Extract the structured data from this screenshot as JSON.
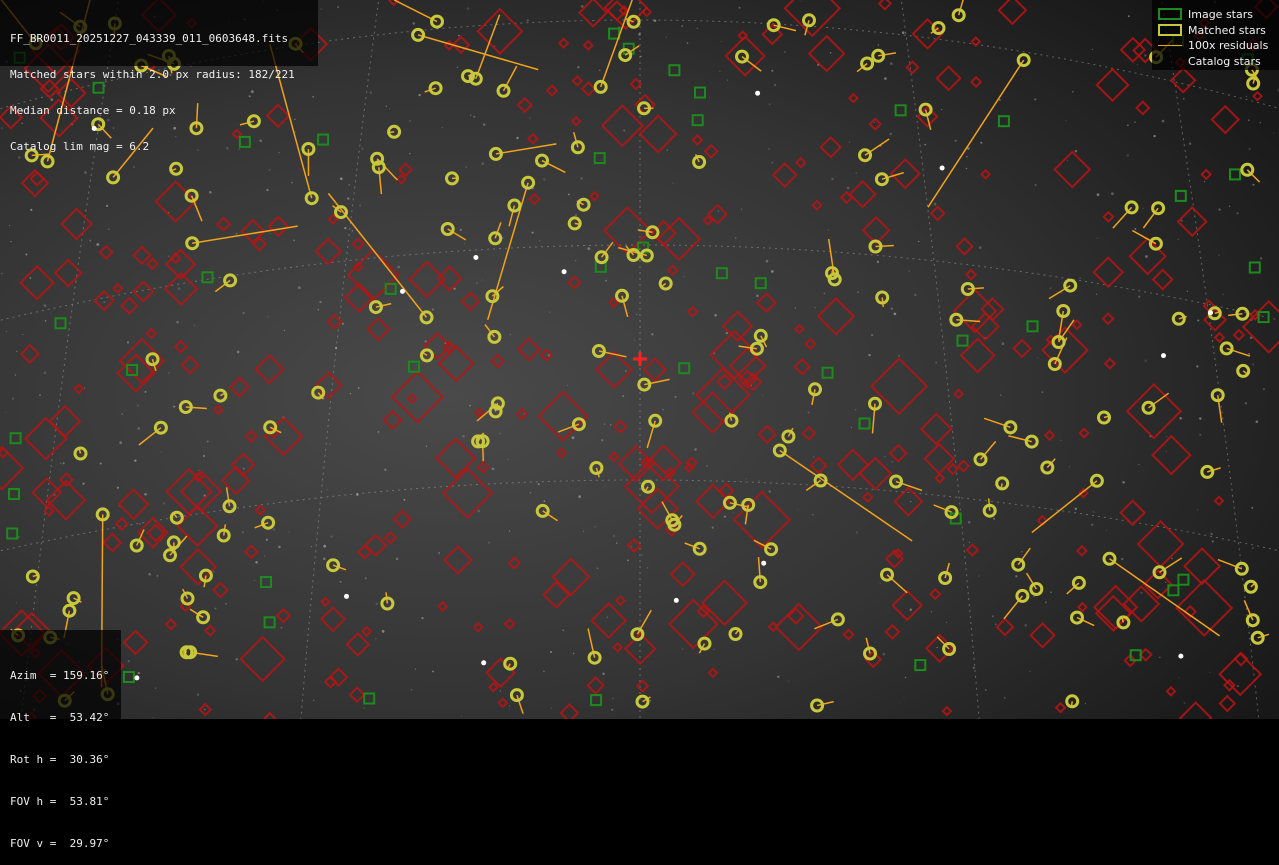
{
  "info": {
    "filename": "FF_BR0011_20251227_043339_011_0603648.fits",
    "matched": "Matched stars within 2.0 px radius: 182/221",
    "median": "Median distance = 0.18 px",
    "catalog": "Catalog lim mag = 6.2"
  },
  "legend": {
    "image_stars": "Image stars",
    "matched_stars": "Matched stars",
    "residuals": "100x residuals",
    "catalog_stars": "Catalog stars"
  },
  "angles": {
    "azim": "Azim  = 159.16°",
    "alt": "Alt   =  53.42°",
    "rot": "Rot h =  30.36°",
    "fovh": "FOV h =  53.81°",
    "fovv": "FOV v =  29.97°"
  },
  "colors": {
    "image_star": "#1d8a1d",
    "matched_star": "#c8c83c",
    "residual": "#f2a31c",
    "catalog_star": "#b81414",
    "center_marker": "#ff2020",
    "grid": "#9a9a9a"
  }
}
